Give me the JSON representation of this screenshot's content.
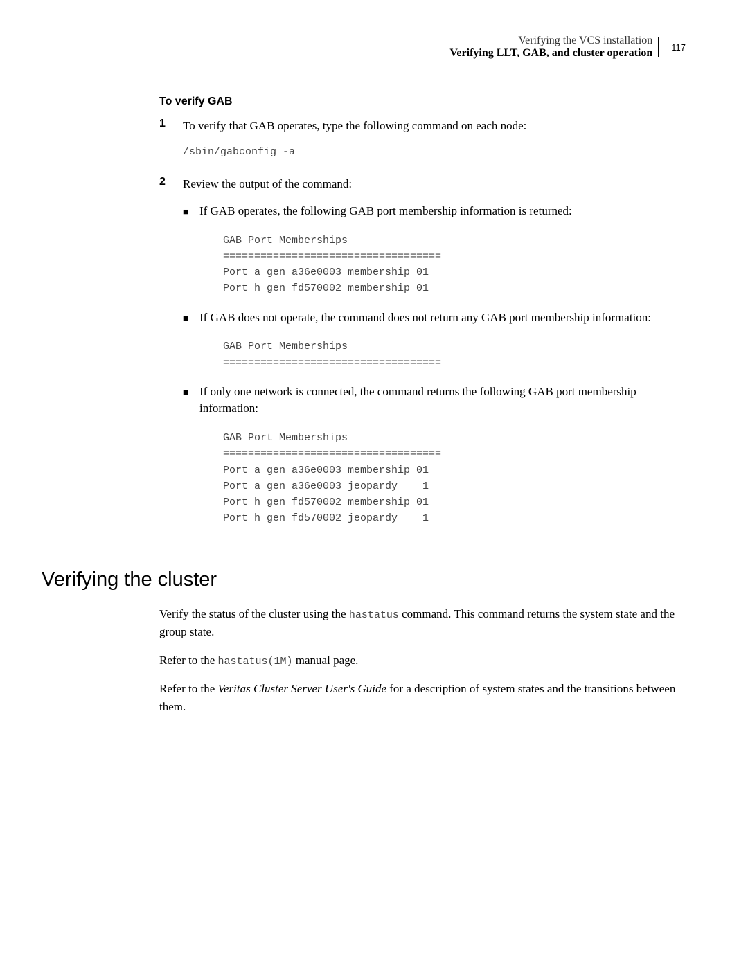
{
  "header": {
    "line1": "Verifying the VCS installation",
    "line2": "Verifying LLT, GAB, and cluster operation",
    "page_num": "117"
  },
  "section_label": "To verify GAB",
  "step1": {
    "num": "1",
    "text": "To verify that GAB operates, type the following command on each node:",
    "code": "/sbin/gabconfig -a"
  },
  "step2": {
    "num": "2",
    "intro": "Review the output of the command:",
    "bullet1": {
      "text": "If GAB operates, the following GAB port membership information is returned:",
      "code": "GAB Port Memberships\n===================================\nPort a gen a36e0003 membership 01\nPort h gen fd570002 membership 01"
    },
    "bullet2": {
      "text": "If GAB does not operate, the command does not return any GAB port membership information:",
      "code": "GAB Port Memberships\n==================================="
    },
    "bullet3": {
      "text": "If only one network is connected, the command returns the following GAB port membership information:",
      "code": "GAB Port Memberships\n===================================\nPort a gen a36e0003 membership 01\nPort a gen a36e0003 jeopardy    1\nPort h gen fd570002 membership 01\nPort h gen fd570002 jeopardy    1"
    }
  },
  "h2": "Verifying the cluster",
  "para1_pre": "Verify the status of the cluster using the ",
  "para1_code": "hastatus",
  "para1_post": " command. This command returns the system state and the group state.",
  "para2_pre": "Refer to the ",
  "para2_code": "hastatus(1M)",
  "para2_post": " manual page.",
  "para3_pre": "Refer to the ",
  "para3_italic": "Veritas Cluster Server User's Guide",
  "para3_post": " for a description of system states and the transitions between them."
}
